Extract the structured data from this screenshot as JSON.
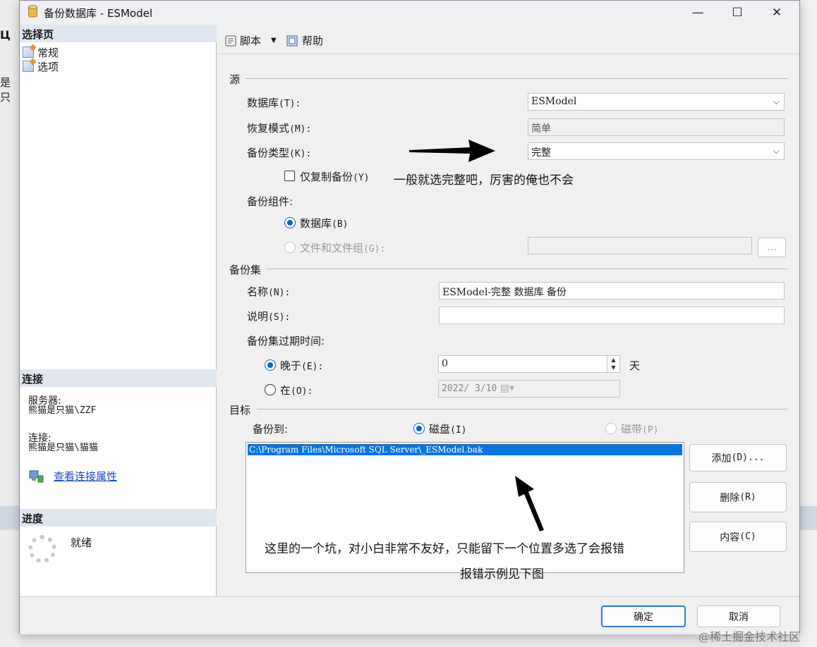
{
  "window": {
    "title": "备份数据库 - ESModel"
  },
  "background": {
    "left_text1": "Ц",
    "left_text2": "是只"
  },
  "left": {
    "select_page_header": "选择页",
    "pages": [
      {
        "label": "常规"
      },
      {
        "label": "选项"
      }
    ],
    "connection_header": "连接",
    "server_label": "服务器:",
    "server_value": "熊猫是只猫\\ZZF",
    "conn_label": "连接:",
    "conn_value": "熊猫是只猫\\猫猫",
    "view_conn_props": "查看连接属性",
    "progress_header": "进度",
    "progress_status": "就绪"
  },
  "toolbar": {
    "script": "脚本",
    "help": "帮助"
  },
  "source": {
    "section": "源",
    "database_label": "数据库",
    "database_acc": "(T):",
    "database_value": "ESModel",
    "recovery_label": "恢复模式",
    "recovery_acc": "(M):",
    "recovery_value": "简单",
    "backup_type_label": "备份类型",
    "backup_type_acc": "(K):",
    "backup_type_value": "完整",
    "copy_only_label": "仅复制备份",
    "copy_only_acc": "(Y)",
    "component_label": "备份组件:",
    "component_db_label": "数据库",
    "component_db_acc": "(B)",
    "component_files_label": "文件和文件组",
    "component_files_acc": "(G):",
    "ellipsis": "..."
  },
  "backup_set": {
    "section": "备份集",
    "name_label": "名称",
    "name_acc": "(N):",
    "name_value": "ESModel-完整 数据库 备份",
    "desc_label": "说明",
    "desc_acc": "(S):",
    "desc_value": "",
    "expire_label": "备份集过期时间:",
    "after_label": "晚于",
    "after_acc": "(E):",
    "after_value": "0",
    "days_unit": "天",
    "on_label": "在",
    "on_acc": "(O):",
    "on_value": "2022/ 3/10"
  },
  "destination": {
    "section": "目标",
    "backup_to_label": "备份到:",
    "disk_label": "磁盘",
    "disk_acc": "(I)",
    "tape_label": "磁带",
    "tape_acc": "(P)",
    "files": [
      "C:\\Program Files\\Microsoft SQL Server\\_ESModel.bak"
    ],
    "add_label": "添加",
    "add_acc": "(D)...",
    "remove_label": "删除",
    "remove_acc": "(R)",
    "contents_label": "内容",
    "contents_acc": "(C)"
  },
  "footer": {
    "ok": "确定",
    "cancel": "取消"
  },
  "annotations": {
    "note1": "一般就选完整吧，厉害的俺也不会",
    "note2": "这里的一个坑，对小白非常不友好，只能留下一个位置多选了会报错",
    "note3": "报错示例见下图"
  },
  "watermark": "@稀土掘金技术社区",
  "colors": {
    "accent": "#0a74d8",
    "link": "#1a45c9",
    "header_bg": "#dfe6f0"
  }
}
